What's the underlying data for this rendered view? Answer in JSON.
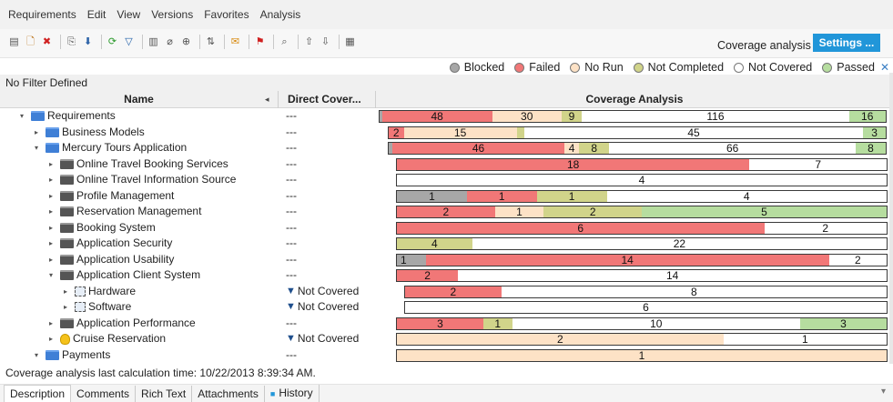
{
  "menu": [
    "Requirements",
    "Edit",
    "View",
    "Versions",
    "Favorites",
    "Analysis"
  ],
  "toolbar_icons": [
    "new-folder-icon",
    "new-requirement-icon",
    "delete-icon",
    "sep",
    "copy-icon",
    "paste-icon",
    "sep",
    "refresh-icon",
    "filter-icon",
    "sep",
    "columns-icon",
    "attachment-icon",
    "zoom-icon",
    "sep",
    "sort-icon",
    "sep",
    "mail-icon",
    "sep",
    "flag-icon",
    "sep",
    "find-icon",
    "sep",
    "move-up-icon",
    "move-down-icon",
    "sep",
    "report-icon"
  ],
  "coverage_title": "Coverage analysis",
  "settings_label": "Settings ...",
  "legend": [
    {
      "label": "Blocked",
      "color": "#a7a7a7"
    },
    {
      "label": "Failed",
      "color": "#f17777"
    },
    {
      "label": "No Run",
      "color": "#fde2c6"
    },
    {
      "label": "Not Completed",
      "color": "#d1d48a"
    },
    {
      "label": "Not Covered",
      "color": "#ffffff"
    },
    {
      "label": "Passed",
      "color": "#b6dd9f"
    }
  ],
  "filter_text": "No Filter Defined",
  "columns": {
    "name": "Name",
    "direct": "Direct Cover...",
    "coverage": "Coverage Analysis"
  },
  "colors": {
    "blocked": "#a7a7a7",
    "failed": "#f17777",
    "norun": "#fde2c6",
    "notcompleted": "#d1d48a",
    "notcovered": "#ffffff",
    "passed": "#b6dd9f"
  },
  "rows": [
    {
      "name": "Requirements",
      "icon": "folder-req-icon",
      "exp": "down",
      "direct": "---",
      "segments": [
        {
          "s": "blocked",
          "n": "",
          "v": 1
        },
        {
          "s": "failed",
          "n": "48",
          "v": 48
        },
        {
          "s": "norun",
          "n": "30",
          "v": 30
        },
        {
          "s": "notcompleted",
          "n": "9",
          "v": 9
        },
        {
          "s": "notcovered",
          "n": "116",
          "v": 116
        },
        {
          "s": "passed",
          "n": "16",
          "v": 16
        }
      ]
    },
    {
      "name": "Business Models",
      "icon": "folder-req-icon",
      "exp": "right",
      "direct": "---",
      "segments": [
        {
          "s": "failed",
          "n": "2",
          "v": 2
        },
        {
          "s": "norun",
          "n": "15",
          "v": 15
        },
        {
          "s": "notcompleted",
          "n": "",
          "v": 1
        },
        {
          "s": "notcovered",
          "n": "45",
          "v": 45
        },
        {
          "s": "passed",
          "n": "3",
          "v": 3
        }
      ]
    },
    {
      "name": "Mercury Tours Application",
      "icon": "folder-req-icon",
      "exp": "down",
      "direct": "---",
      "segments": [
        {
          "s": "blocked",
          "n": "",
          "v": 1
        },
        {
          "s": "failed",
          "n": "46",
          "v": 46
        },
        {
          "s": "norun",
          "n": "4",
          "v": 4
        },
        {
          "s": "notcompleted",
          "n": "8",
          "v": 8
        },
        {
          "s": "notcovered",
          "n": "66",
          "v": 66
        },
        {
          "s": "passed",
          "n": "8",
          "v": 8
        }
      ]
    },
    {
      "name": "Online Travel Booking Services",
      "icon": "folder-plain-icon",
      "exp": "right",
      "direct": "---",
      "segments": [
        {
          "s": "failed",
          "n": "18",
          "v": 18
        },
        {
          "s": "notcovered",
          "n": "7",
          "v": 7
        }
      ]
    },
    {
      "name": "Online Travel Information Source",
      "icon": "folder-plain-icon",
      "exp": "right",
      "direct": "---",
      "segments": [
        {
          "s": "notcovered",
          "n": "4",
          "v": 4
        }
      ]
    },
    {
      "name": "Profile Management",
      "icon": "folder-plain-icon",
      "exp": "right",
      "direct": "---",
      "segments": [
        {
          "s": "blocked",
          "n": "1",
          "v": 1
        },
        {
          "s": "failed",
          "n": "1",
          "v": 1
        },
        {
          "s": "notcompleted",
          "n": "1",
          "v": 1
        },
        {
          "s": "notcovered",
          "n": "4",
          "v": 4
        }
      ]
    },
    {
      "name": "Reservation Management",
      "icon": "folder-plain-icon",
      "exp": "right",
      "direct": "---",
      "segments": [
        {
          "s": "failed",
          "n": "2",
          "v": 2
        },
        {
          "s": "norun",
          "n": "1",
          "v": 1
        },
        {
          "s": "notcompleted",
          "n": "2",
          "v": 2
        },
        {
          "s": "passed",
          "n": "5",
          "v": 5
        }
      ]
    },
    {
      "name": "Booking System",
      "icon": "folder-plain-icon",
      "exp": "right",
      "direct": "---",
      "segments": [
        {
          "s": "failed",
          "n": "6",
          "v": 6
        },
        {
          "s": "notcovered",
          "n": "2",
          "v": 2
        }
      ]
    },
    {
      "name": "Application Security",
      "icon": "folder-plain-icon",
      "exp": "right",
      "direct": "---",
      "segments": [
        {
          "s": "notcompleted",
          "n": "4",
          "v": 4
        },
        {
          "s": "notcovered",
          "n": "22",
          "v": 22
        }
      ]
    },
    {
      "name": "Application Usability",
      "icon": "folder-plain-icon",
      "exp": "right",
      "direct": "---",
      "segments": [
        {
          "s": "blocked",
          "n": "1",
          "v": 1
        },
        {
          "s": "failed",
          "n": "14",
          "v": 14
        },
        {
          "s": "notcovered",
          "n": "2",
          "v": 2
        }
      ]
    },
    {
      "name": "Application Client System",
      "icon": "folder-plain-icon",
      "exp": "down",
      "direct": "---",
      "segments": [
        {
          "s": "failed",
          "n": "2",
          "v": 2
        },
        {
          "s": "notcovered",
          "n": "14",
          "v": 14
        }
      ]
    },
    {
      "name": "Hardware",
      "icon": "requirement-dashed-icon",
      "exp": "right",
      "direct": "Not Covered",
      "segments": [
        {
          "s": "failed",
          "n": "2",
          "v": 2
        },
        {
          "s": "notcovered",
          "n": "8",
          "v": 8
        }
      ]
    },
    {
      "name": "Software",
      "icon": "requirement-dashed-icon",
      "exp": "right",
      "direct": "Not Covered",
      "segments": [
        {
          "s": "notcovered",
          "n": "6",
          "v": 6
        }
      ]
    },
    {
      "name": "Application Performance",
      "icon": "folder-plain-icon",
      "exp": "right",
      "direct": "---",
      "segments": [
        {
          "s": "failed",
          "n": "3",
          "v": 3
        },
        {
          "s": "notcompleted",
          "n": "1",
          "v": 1
        },
        {
          "s": "notcovered",
          "n": "10",
          "v": 10
        },
        {
          "s": "passed",
          "n": "3",
          "v": 3
        }
      ]
    },
    {
      "name": "Cruise Reservation",
      "icon": "lightbulb-icon",
      "exp": "right",
      "direct": "Not Covered",
      "segments": [
        {
          "s": "norun",
          "n": "2",
          "v": 2
        },
        {
          "s": "notcovered",
          "n": "1",
          "v": 1
        }
      ]
    },
    {
      "name": "Payments",
      "icon": "folder-req-icon",
      "exp": "down",
      "direct": "---",
      "segments": [
        {
          "s": "norun",
          "n": "1",
          "v": 1
        }
      ]
    }
  ],
  "status_text": "Coverage analysis last calculation time: 10/22/2013 8:39:34 AM.",
  "tabs": [
    "Description",
    "Comments",
    "Rich Text",
    "Attachments",
    "History"
  ]
}
